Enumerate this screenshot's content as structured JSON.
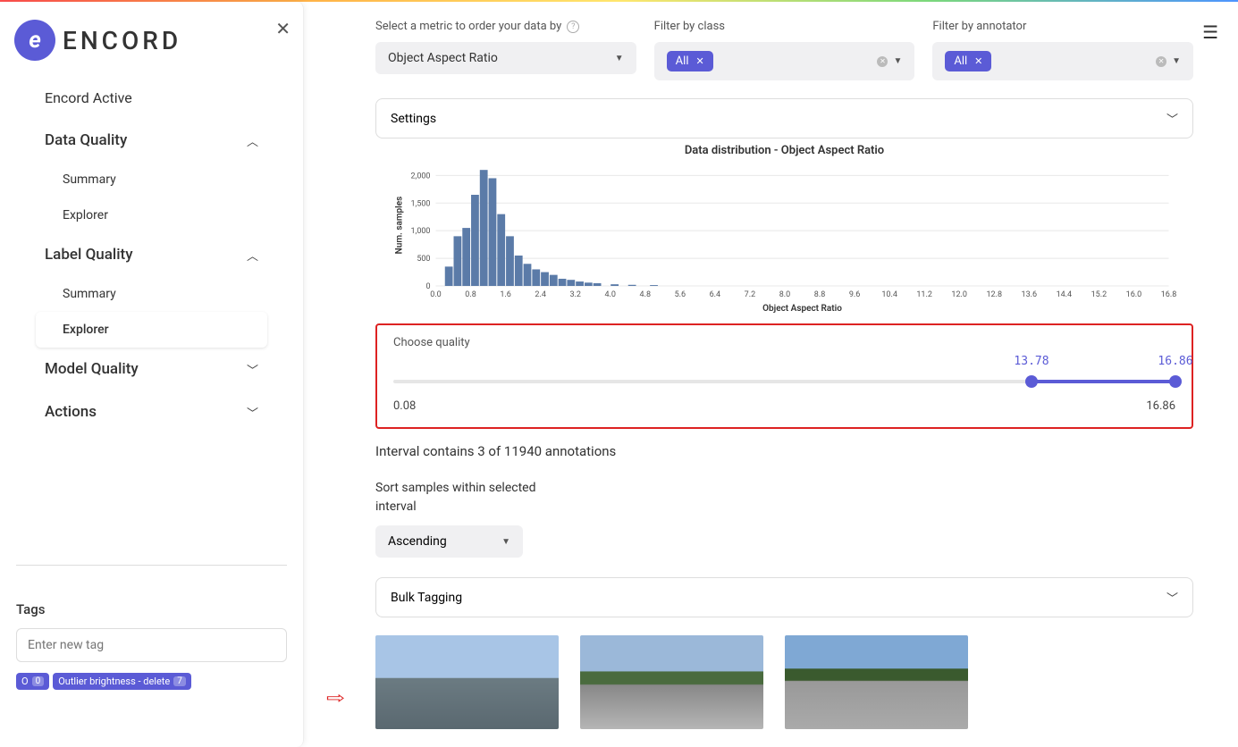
{
  "brand": "ENCORD",
  "sidebar": {
    "items": [
      {
        "label": "Encord Active",
        "type": "plain"
      },
      {
        "label": "Data Quality",
        "type": "section",
        "chevron": "up"
      },
      {
        "label": "Summary",
        "type": "sub"
      },
      {
        "label": "Explorer",
        "type": "sub"
      },
      {
        "label": "Label Quality",
        "type": "section",
        "chevron": "up"
      },
      {
        "label": "Summary",
        "type": "sub"
      },
      {
        "label": "Explorer",
        "type": "sub",
        "active": true
      },
      {
        "label": "Model Quality",
        "type": "section",
        "chevron": "down"
      },
      {
        "label": "Actions",
        "type": "section",
        "chevron": "down"
      }
    ],
    "tags_title": "Tags",
    "tag_placeholder": "Enter new tag",
    "tag_badges": [
      {
        "label": "O",
        "count": "0"
      },
      {
        "label": "Outlier brightness - delete",
        "count": "7"
      }
    ]
  },
  "filters": {
    "metric_label": "Select a metric to order your data by",
    "metric_value": "Object Aspect Ratio",
    "class_label": "Filter by class",
    "class_value": "All",
    "annotator_label": "Filter by annotator",
    "annotator_value": "All"
  },
  "settings_label": "Settings",
  "chart_data": {
    "type": "bar",
    "title": "Data distribution - Object Aspect Ratio",
    "xlabel": "Object Aspect Ratio",
    "ylabel": "Num. samples",
    "ylim": [
      0,
      2200
    ],
    "yticks": [
      0,
      500,
      1000,
      1500,
      2000
    ],
    "xlim": [
      0.0,
      16.8
    ],
    "xticks": [
      0.0,
      0.8,
      1.6,
      2.4,
      3.2,
      4.0,
      4.8,
      5.6,
      6.4,
      7.2,
      8.0,
      8.8,
      9.6,
      10.4,
      11.2,
      12.0,
      12.8,
      13.6,
      14.4,
      15.2,
      16.0,
      16.8
    ],
    "bars": [
      {
        "x": 0.3,
        "y": 350
      },
      {
        "x": 0.5,
        "y": 900
      },
      {
        "x": 0.7,
        "y": 1050
      },
      {
        "x": 0.9,
        "y": 1650
      },
      {
        "x": 1.1,
        "y": 2100
      },
      {
        "x": 1.3,
        "y": 1950
      },
      {
        "x": 1.5,
        "y": 1300
      },
      {
        "x": 1.7,
        "y": 900
      },
      {
        "x": 1.9,
        "y": 550
      },
      {
        "x": 2.1,
        "y": 400
      },
      {
        "x": 2.3,
        "y": 300
      },
      {
        "x": 2.5,
        "y": 250
      },
      {
        "x": 2.7,
        "y": 200
      },
      {
        "x": 2.9,
        "y": 130
      },
      {
        "x": 3.1,
        "y": 110
      },
      {
        "x": 3.3,
        "y": 80
      },
      {
        "x": 3.5,
        "y": 60
      },
      {
        "x": 3.7,
        "y": 50
      },
      {
        "x": 4.1,
        "y": 30
      },
      {
        "x": 4.5,
        "y": 20
      },
      {
        "x": 5.0,
        "y": 15
      }
    ]
  },
  "quality": {
    "label": "Choose quality",
    "min": "0.08",
    "max": "16.86",
    "low": "13.78",
    "high": "16.86",
    "low_pct": 81.6,
    "high_pct": 100
  },
  "interval_text": "Interval contains 3 of 11940 annotations",
  "sort": {
    "label": "Sort samples within selected interval",
    "value": "Ascending"
  },
  "bulk_label": "Bulk Tagging"
}
